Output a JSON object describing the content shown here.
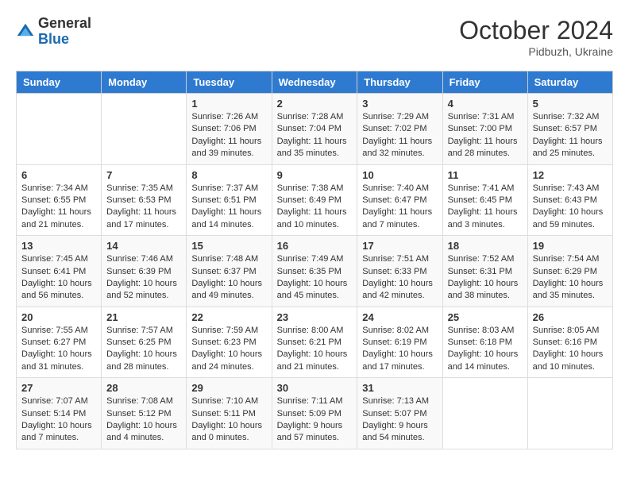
{
  "header": {
    "logo": {
      "general": "General",
      "blue": "Blue"
    },
    "title": "October 2024",
    "location": "Pidbuzh, Ukraine"
  },
  "weekdays": [
    "Sunday",
    "Monday",
    "Tuesday",
    "Wednesday",
    "Thursday",
    "Friday",
    "Saturday"
  ],
  "weeks": [
    [
      {
        "day": "",
        "sunrise": "",
        "sunset": "",
        "daylight": ""
      },
      {
        "day": "",
        "sunrise": "",
        "sunset": "",
        "daylight": ""
      },
      {
        "day": "1",
        "sunrise": "Sunrise: 7:26 AM",
        "sunset": "Sunset: 7:06 PM",
        "daylight": "Daylight: 11 hours and 39 minutes."
      },
      {
        "day": "2",
        "sunrise": "Sunrise: 7:28 AM",
        "sunset": "Sunset: 7:04 PM",
        "daylight": "Daylight: 11 hours and 35 minutes."
      },
      {
        "day": "3",
        "sunrise": "Sunrise: 7:29 AM",
        "sunset": "Sunset: 7:02 PM",
        "daylight": "Daylight: 11 hours and 32 minutes."
      },
      {
        "day": "4",
        "sunrise": "Sunrise: 7:31 AM",
        "sunset": "Sunset: 7:00 PM",
        "daylight": "Daylight: 11 hours and 28 minutes."
      },
      {
        "day": "5",
        "sunrise": "Sunrise: 7:32 AM",
        "sunset": "Sunset: 6:57 PM",
        "daylight": "Daylight: 11 hours and 25 minutes."
      }
    ],
    [
      {
        "day": "6",
        "sunrise": "Sunrise: 7:34 AM",
        "sunset": "Sunset: 6:55 PM",
        "daylight": "Daylight: 11 hours and 21 minutes."
      },
      {
        "day": "7",
        "sunrise": "Sunrise: 7:35 AM",
        "sunset": "Sunset: 6:53 PM",
        "daylight": "Daylight: 11 hours and 17 minutes."
      },
      {
        "day": "8",
        "sunrise": "Sunrise: 7:37 AM",
        "sunset": "Sunset: 6:51 PM",
        "daylight": "Daylight: 11 hours and 14 minutes."
      },
      {
        "day": "9",
        "sunrise": "Sunrise: 7:38 AM",
        "sunset": "Sunset: 6:49 PM",
        "daylight": "Daylight: 11 hours and 10 minutes."
      },
      {
        "day": "10",
        "sunrise": "Sunrise: 7:40 AM",
        "sunset": "Sunset: 6:47 PM",
        "daylight": "Daylight: 11 hours and 7 minutes."
      },
      {
        "day": "11",
        "sunrise": "Sunrise: 7:41 AM",
        "sunset": "Sunset: 6:45 PM",
        "daylight": "Daylight: 11 hours and 3 minutes."
      },
      {
        "day": "12",
        "sunrise": "Sunrise: 7:43 AM",
        "sunset": "Sunset: 6:43 PM",
        "daylight": "Daylight: 10 hours and 59 minutes."
      }
    ],
    [
      {
        "day": "13",
        "sunrise": "Sunrise: 7:45 AM",
        "sunset": "Sunset: 6:41 PM",
        "daylight": "Daylight: 10 hours and 56 minutes."
      },
      {
        "day": "14",
        "sunrise": "Sunrise: 7:46 AM",
        "sunset": "Sunset: 6:39 PM",
        "daylight": "Daylight: 10 hours and 52 minutes."
      },
      {
        "day": "15",
        "sunrise": "Sunrise: 7:48 AM",
        "sunset": "Sunset: 6:37 PM",
        "daylight": "Daylight: 10 hours and 49 minutes."
      },
      {
        "day": "16",
        "sunrise": "Sunrise: 7:49 AM",
        "sunset": "Sunset: 6:35 PM",
        "daylight": "Daylight: 10 hours and 45 minutes."
      },
      {
        "day": "17",
        "sunrise": "Sunrise: 7:51 AM",
        "sunset": "Sunset: 6:33 PM",
        "daylight": "Daylight: 10 hours and 42 minutes."
      },
      {
        "day": "18",
        "sunrise": "Sunrise: 7:52 AM",
        "sunset": "Sunset: 6:31 PM",
        "daylight": "Daylight: 10 hours and 38 minutes."
      },
      {
        "day": "19",
        "sunrise": "Sunrise: 7:54 AM",
        "sunset": "Sunset: 6:29 PM",
        "daylight": "Daylight: 10 hours and 35 minutes."
      }
    ],
    [
      {
        "day": "20",
        "sunrise": "Sunrise: 7:55 AM",
        "sunset": "Sunset: 6:27 PM",
        "daylight": "Daylight: 10 hours and 31 minutes."
      },
      {
        "day": "21",
        "sunrise": "Sunrise: 7:57 AM",
        "sunset": "Sunset: 6:25 PM",
        "daylight": "Daylight: 10 hours and 28 minutes."
      },
      {
        "day": "22",
        "sunrise": "Sunrise: 7:59 AM",
        "sunset": "Sunset: 6:23 PM",
        "daylight": "Daylight: 10 hours and 24 minutes."
      },
      {
        "day": "23",
        "sunrise": "Sunrise: 8:00 AM",
        "sunset": "Sunset: 6:21 PM",
        "daylight": "Daylight: 10 hours and 21 minutes."
      },
      {
        "day": "24",
        "sunrise": "Sunrise: 8:02 AM",
        "sunset": "Sunset: 6:19 PM",
        "daylight": "Daylight: 10 hours and 17 minutes."
      },
      {
        "day": "25",
        "sunrise": "Sunrise: 8:03 AM",
        "sunset": "Sunset: 6:18 PM",
        "daylight": "Daylight: 10 hours and 14 minutes."
      },
      {
        "day": "26",
        "sunrise": "Sunrise: 8:05 AM",
        "sunset": "Sunset: 6:16 PM",
        "daylight": "Daylight: 10 hours and 10 minutes."
      }
    ],
    [
      {
        "day": "27",
        "sunrise": "Sunrise: 7:07 AM",
        "sunset": "Sunset: 5:14 PM",
        "daylight": "Daylight: 10 hours and 7 minutes."
      },
      {
        "day": "28",
        "sunrise": "Sunrise: 7:08 AM",
        "sunset": "Sunset: 5:12 PM",
        "daylight": "Daylight: 10 hours and 4 minutes."
      },
      {
        "day": "29",
        "sunrise": "Sunrise: 7:10 AM",
        "sunset": "Sunset: 5:11 PM",
        "daylight": "Daylight: 10 hours and 0 minutes."
      },
      {
        "day": "30",
        "sunrise": "Sunrise: 7:11 AM",
        "sunset": "Sunset: 5:09 PM",
        "daylight": "Daylight: 9 hours and 57 minutes."
      },
      {
        "day": "31",
        "sunrise": "Sunrise: 7:13 AM",
        "sunset": "Sunset: 5:07 PM",
        "daylight": "Daylight: 9 hours and 54 minutes."
      },
      {
        "day": "",
        "sunrise": "",
        "sunset": "",
        "daylight": ""
      },
      {
        "day": "",
        "sunrise": "",
        "sunset": "",
        "daylight": ""
      }
    ]
  ]
}
